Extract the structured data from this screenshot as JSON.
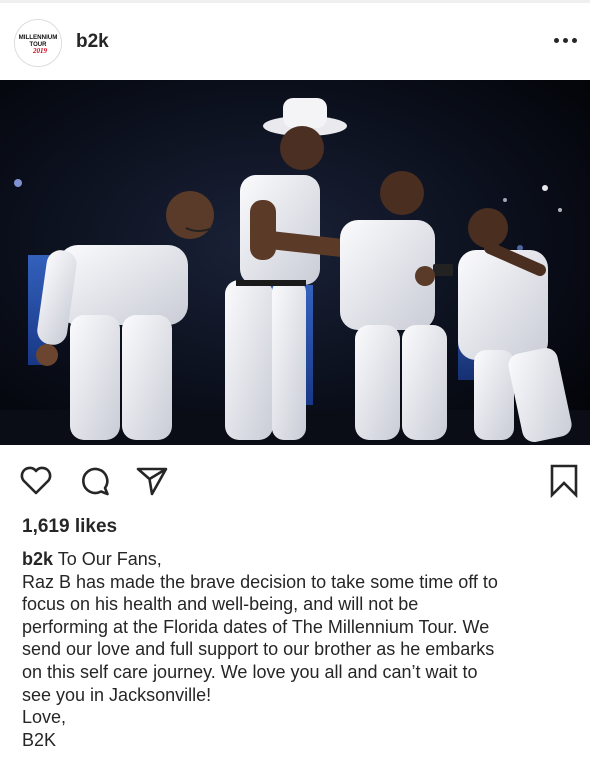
{
  "post": {
    "header": {
      "username": "b2k",
      "avatar": {
        "logo_line1": "MILLENNIUM",
        "logo_line2": "TOUR",
        "logo_line3": "2019"
      },
      "more_icon": "more-horizontal-icon"
    },
    "actions": {
      "like_icon": "heart-icon",
      "comment_icon": "comment-icon",
      "share_icon": "share-icon",
      "save_icon": "bookmark-icon"
    },
    "likes_text": "1,619 likes",
    "caption": {
      "username": "b2k",
      "first_line": "To Our Fans,",
      "body_lines": [
        "Raz B has made the brave decision to take some time off to",
        "focus on his health and well-being, and will not be",
        "performing at the Florida dates of The Millennium Tour. We",
        "send our love and full support to our brother as he embarks",
        "on this self care journey. We love you all and can’t wait to",
        "see you in Jacksonville!",
        "Love,",
        "B2K"
      ]
    }
  },
  "colors": {
    "text": "#262626",
    "divider": "#efefef",
    "logo_red": "#d0021b"
  }
}
